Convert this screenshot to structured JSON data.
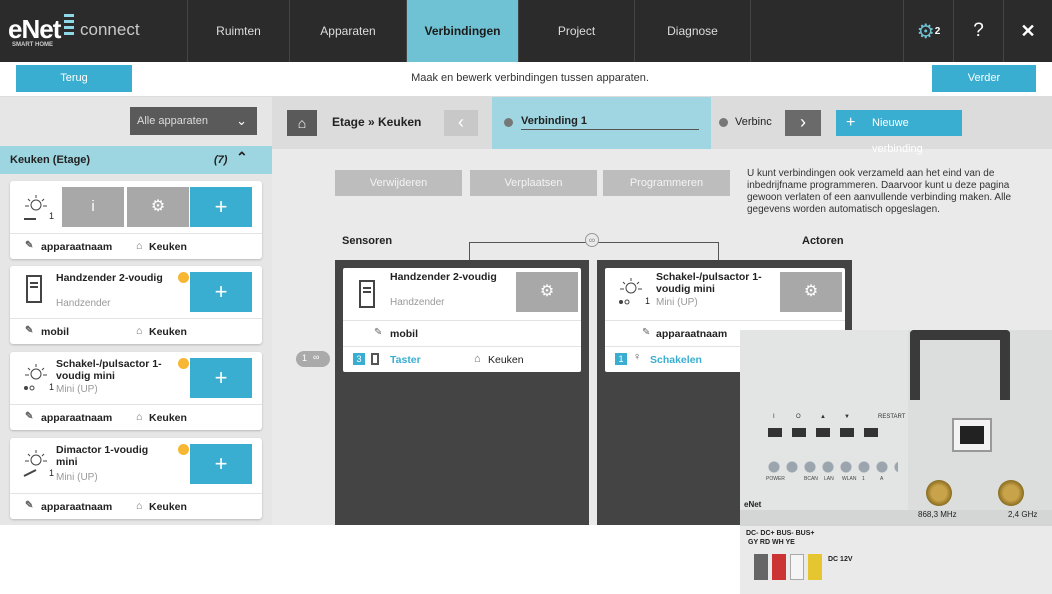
{
  "app": {
    "logo_main": "eNet",
    "logo_sub": "connect",
    "logo_tag": "SMART HOME"
  },
  "nav": {
    "items": [
      {
        "label": "Ruimten"
      },
      {
        "label": "Apparaten"
      },
      {
        "label": "Verbindingen"
      },
      {
        "label": "Project"
      },
      {
        "label": "Diagnose"
      }
    ],
    "settings_badge": "2",
    "help_label": "?",
    "close_label": "✕"
  },
  "subbar": {
    "back_label": "Terug",
    "instruction": "Maak en bewerk verbindingen tussen apparaten.",
    "next_label": "Verder"
  },
  "left": {
    "dropdown_label": "Alle apparaten",
    "group": {
      "title": "Keuken (Etage)",
      "count": "(7)"
    },
    "cards": [
      {
        "title": "",
        "subtitle": "",
        "name": "apparaatnaam",
        "room": "Keuken",
        "num": "1"
      },
      {
        "title": "Handzender 2-voudig",
        "subtitle": "Handzender",
        "name": "mobil",
        "room": "Keuken"
      },
      {
        "title": "Schakel-/pulsactor 1-voudig mini",
        "subtitle": "Mini (UP)",
        "name": "apparaatnaam",
        "room": "Keuken",
        "num": "1"
      },
      {
        "title": "Dimactor 1-voudig mini",
        "subtitle": "Mini (UP)",
        "name": "apparaatnaam",
        "room": "Keuken",
        "num": "1"
      }
    ],
    "card0_info": "i"
  },
  "main": {
    "breadcrumb": "Etage » Keuken",
    "active_tab": "Verbinding 1",
    "next_tab": "Verbinc",
    "new_connection": "Nieuwe verbinding",
    "actions": [
      "Verwijderen",
      "Verplaatsen",
      "Programmeren"
    ],
    "hint": "U kunt verbindingen ook verzameld aan het eind van de inbedrijfname programmeren. Daarvoor kunt u deze pagina gewoon verlaten of een aanvullende verbinding maken. Alle gegevens worden automatisch opgeslagen.",
    "sensors_label": "Sensoren",
    "actors_label": "Actoren",
    "sensor_card": {
      "title": "Handzender 2-voudig",
      "subtitle": "Handzender",
      "name": "mobil",
      "channel": "3",
      "function": "Taster",
      "room": "Keuken"
    },
    "actor_card": {
      "title": "Schakel-/pulsactor 1-voudig mini",
      "subtitle": "Mini (UP)",
      "num": "1",
      "name": "apparaatnaam",
      "channel": "1",
      "function": "Schakelen"
    },
    "link_count": "1"
  },
  "photo": {
    "button_labels": [
      "I",
      "O",
      "▲",
      "▼",
      "RESTART"
    ],
    "led_labels": [
      "POWER",
      "",
      "BCAN",
      "LAN",
      "WLAN",
      "1",
      "A"
    ],
    "freq1": "868,3 MHz",
    "freq2": "2,4 GHz",
    "terminals": "DC- DC+ BUS- BUS+",
    "terminal_colors": "GY RD WH YE",
    "dc_label": "DC 12V",
    "brand": "eNet"
  },
  "colors": {
    "accent": "#39aed0",
    "nav_bg": "#2b2b2b",
    "active_tab": "#6fc2d3",
    "dot": "#f7b733"
  }
}
